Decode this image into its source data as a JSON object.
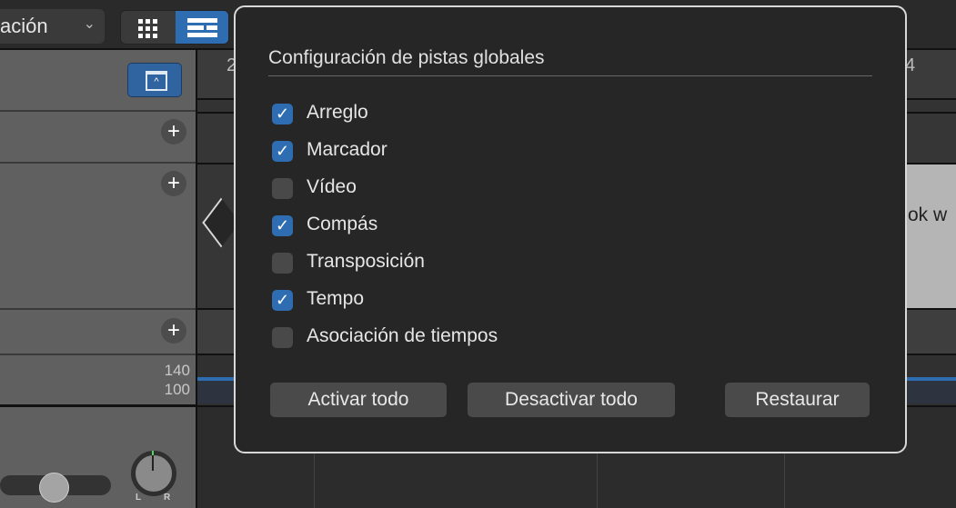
{
  "toolbar": {
    "dropdown_label": "ación"
  },
  "left_panel": {
    "tempo_values": [
      "140",
      "100"
    ],
    "pan_left": "L",
    "pan_right": "R"
  },
  "ruler": {
    "bar_2": "2",
    "bar_4": "4"
  },
  "region": {
    "text": "ok w"
  },
  "popover": {
    "title": "Configuración de pistas globales",
    "options": [
      {
        "label": "Arreglo",
        "checked": true
      },
      {
        "label": "Marcador",
        "checked": true
      },
      {
        "label": "Vídeo",
        "checked": false
      },
      {
        "label": "Compás",
        "checked": true
      },
      {
        "label": "Transposición",
        "checked": false
      },
      {
        "label": "Tempo",
        "checked": true
      },
      {
        "label": "Asociación de tiempos",
        "checked": false
      }
    ],
    "buttons": {
      "activate_all": "Activar todo",
      "deactivate_all": "Desactivar todo",
      "restore": "Restaurar"
    }
  },
  "colors": {
    "accent": "#2f6db2",
    "tempo_line": "#2f6db2"
  }
}
